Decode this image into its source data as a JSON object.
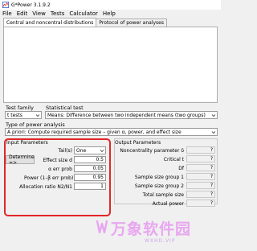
{
  "window": {
    "title": "G*Power 3.1.9.2"
  },
  "menu": [
    "File",
    "Edit",
    "View",
    "Tests",
    "Calculator",
    "Help"
  ],
  "tabs": [
    "Central and noncentral distributions",
    "Protocol of power analyses"
  ],
  "test_family": {
    "label": "Test family",
    "value": "t tests"
  },
  "statistical_test": {
    "label": "Statistical test",
    "value": "Means: Difference between two independent means (two groups)"
  },
  "type_of_power_analysis": {
    "label": "Type of power analysis",
    "value": "A priori: Compute required sample size – given α, power, and effect size"
  },
  "input": {
    "title": "Input Parameters",
    "determine_button": "Determine =>",
    "tails": {
      "label": "Tail(s)",
      "value": "One"
    },
    "effect_size": {
      "label": "Effect size d",
      "value": "0.5"
    },
    "alpha": {
      "label": "α err prob",
      "value": "0.05"
    },
    "power": {
      "label": "Power (1–β err prob)",
      "value": "0.95"
    },
    "allocation": {
      "label": "Allocation ratio N2/N1",
      "value": "1"
    }
  },
  "output": {
    "title": "Output Parameters",
    "rows": [
      {
        "label": "Noncentrality parameter δ",
        "value": "?"
      },
      {
        "label": "Critical t",
        "value": "?"
      },
      {
        "label": "Df",
        "value": "?"
      },
      {
        "label": "Sample size group 1",
        "value": "?"
      },
      {
        "label": "Sample size group 2",
        "value": "?"
      },
      {
        "label": "Total sample size",
        "value": "?"
      },
      {
        "label": "Actual power",
        "value": "?"
      }
    ]
  },
  "watermark": {
    "brand": "万象软件园",
    "url": "WXHD.VIP"
  },
  "colors": {
    "highlight_border": "#e22727",
    "watermark": "#e8a6f0"
  }
}
